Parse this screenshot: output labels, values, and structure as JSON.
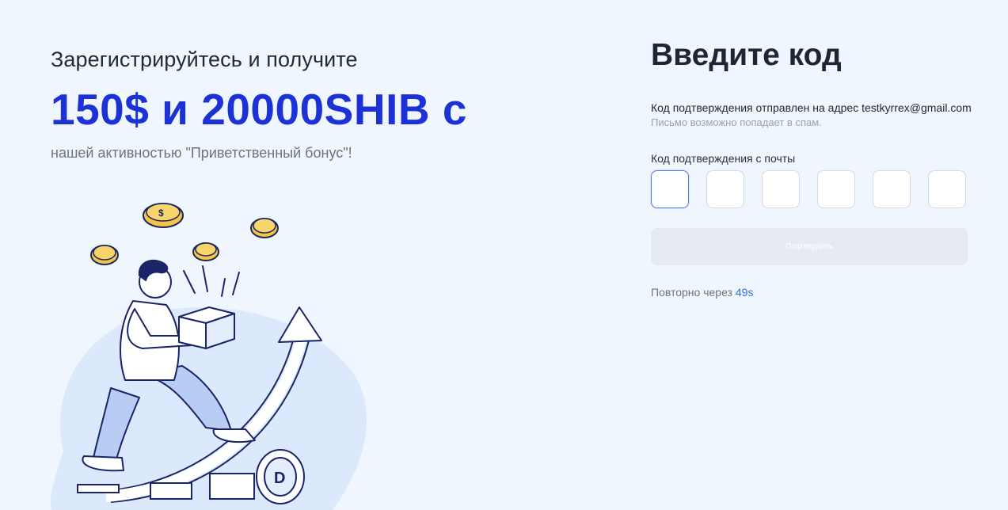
{
  "promo": {
    "line1": "Зарегистрируйтесь и получите",
    "amount": "150$ и 20000SHIB с",
    "line3": "нашей активностью \"Приветственный бонус\"!"
  },
  "verify": {
    "title": "Введите код",
    "sent_text": "Код подтверждения отправлен на адрес testkyrrex@gmail.com",
    "spam_text": "Письмо возможно попадает в спам.",
    "code_label": "Код подтверждения с почты",
    "code_digits": [
      "",
      "",
      "",
      "",
      "",
      ""
    ],
    "confirm_label": "Подтвердить",
    "resend_prefix": "Повторно через",
    "resend_timer": "49s"
  },
  "colors": {
    "accent": "#1d32d6",
    "link": "#2f6fdf",
    "background": "#f0f6fd"
  },
  "illustration": {
    "icons": [
      "person-with-box",
      "growth-arrow",
      "coin-stacks",
      "flying-coins"
    ]
  }
}
